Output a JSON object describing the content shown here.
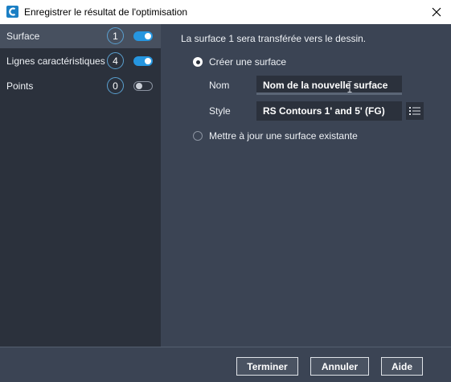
{
  "window": {
    "title": "Enregistrer le résultat de l'optimisation",
    "icons": {
      "app": "civil3d-logo-icon",
      "close": "close-icon"
    },
    "colors": {
      "accent": "#2696e0",
      "panel": "#3b4454",
      "sidebar": "#2b313c"
    }
  },
  "sidebar": {
    "items": [
      {
        "label": "Surface",
        "count": "1",
        "enabled": true,
        "active": true
      },
      {
        "label": "Lignes caractéristiques",
        "count": "4",
        "enabled": true,
        "active": false
      },
      {
        "label": "Points",
        "count": "0",
        "enabled": false,
        "active": false
      }
    ]
  },
  "main": {
    "info_text": "La surface 1 sera transférée vers le dessin.",
    "option_create": {
      "label": "Créer une surface",
      "selected": true
    },
    "name_field": {
      "label": "Nom",
      "value": "Nom de la nouvelle surface"
    },
    "style_field": {
      "label": "Style",
      "value": "RS Contours 1' and 5' (FG)",
      "icon": "list-icon"
    },
    "option_update": {
      "label": "Mettre à jour une surface existante",
      "selected": false
    }
  },
  "footer": {
    "finish": "Terminer",
    "cancel": "Annuler",
    "help": "Aide"
  }
}
